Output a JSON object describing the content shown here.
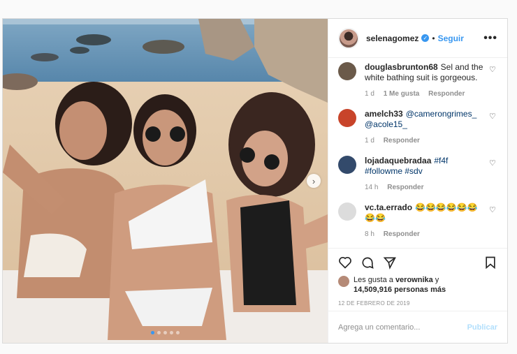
{
  "post": {
    "username": "selenagomez",
    "separator": "•",
    "follow_label": "Seguir",
    "more_label": "•••",
    "next_label": "›",
    "carousel": {
      "count": 5,
      "active_index": 0
    }
  },
  "comments": [
    {
      "user": "douglasbrunton68",
      "text": "Sel and the white bathing suit is gorgeous.",
      "time": "1 d",
      "likes": "1 Me gusta",
      "reply": "Responder",
      "avatar_color": "#6b5a4a"
    },
    {
      "user": "amelch33",
      "text": "@camerongrimes_ @acole15_",
      "time": "1 d",
      "likes": "",
      "reply": "Responder",
      "avatar_color": "#c8442a"
    },
    {
      "user": "lojadaquebradaa",
      "text": "#f4f #followme #sdv",
      "time": "14 h",
      "likes": "",
      "reply": "Responder",
      "avatar_color": "#334a6b"
    },
    {
      "user": "vc.ta.errado",
      "text": "😂😂😂😂😂😂😂😂",
      "time": "8 h",
      "likes": "",
      "reply": "Responder",
      "avatar_color": "#dcdcdc"
    }
  ],
  "likes": {
    "prefix": "Les gusta a ",
    "user": "verownika",
    "middle": " y",
    "count": "14,509,916 personas más"
  },
  "date": "12 DE FEBRERO DE 2019",
  "add_comment": {
    "placeholder": "Agrega un comentario...",
    "publish_label": "Publicar"
  },
  "icons": {
    "heart": "heart-icon",
    "comment": "comment-icon",
    "share": "share-icon",
    "save": "bookmark-icon",
    "verified": "verified-badge-icon"
  },
  "colors": {
    "accent": "#3897f0",
    "publish_disabled": "#b2dffc"
  }
}
